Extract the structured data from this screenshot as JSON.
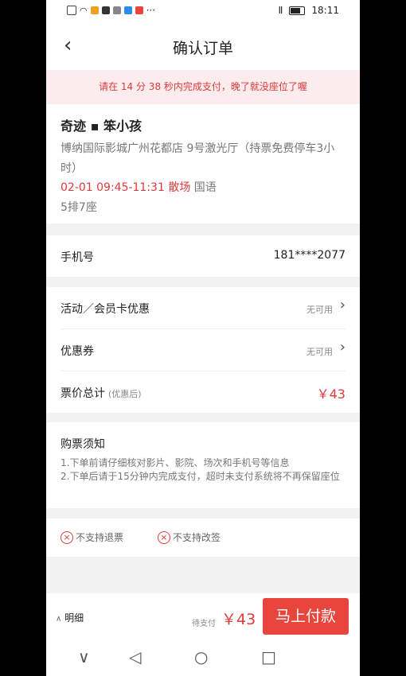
{
  "status_bar": {
    "time": "18:11",
    "icons": [
      "sim-icon",
      "wifi-icon",
      "app-notification-icons",
      "vibrate-icon",
      "battery-icon"
    ]
  },
  "header": {
    "back_icon": "chevron-left-icon",
    "title": "确认订单"
  },
  "timer_banner": {
    "text": "请在 14 分 38 秒内完成支付，晚了就没座位了喔"
  },
  "movie": {
    "title": "奇迹 ▪ 笨小孩",
    "cinema": "博纳国际影城广州花都店 9号激光厅（持票免费停车3小时）",
    "showtime": "02-01 09:45-11:31 散场",
    "language": "国语",
    "seat": "5排7座"
  },
  "phone_row": {
    "label": "手机号",
    "value": "181****2077"
  },
  "discounts": {
    "activity_label": "活动／会员卡优惠",
    "activity_value": "无可用",
    "coupon_label": "优惠券",
    "coupon_value": "无可用",
    "total_label": "票价总计",
    "total_note": "(优惠后)",
    "total_price": "￥43"
  },
  "notice": {
    "title": "购票须知",
    "line1": "1.下单前请仔细核对影片、影院、场次和手机号等信息",
    "line2": "2.下单后请于15分钟内完成支付，超时未支付系统将不再保留座位"
  },
  "policy": {
    "no_refund": "不支持退票",
    "no_change": "不支持改签"
  },
  "pay_bar": {
    "detail_label": "明细",
    "pending_label": "待支付",
    "amount": "￥43",
    "pay_button": "马上付款"
  },
  "colors": {
    "accent": "#e8453c",
    "price_red": "#e03a3a",
    "banner_bg": "#fdeced"
  }
}
